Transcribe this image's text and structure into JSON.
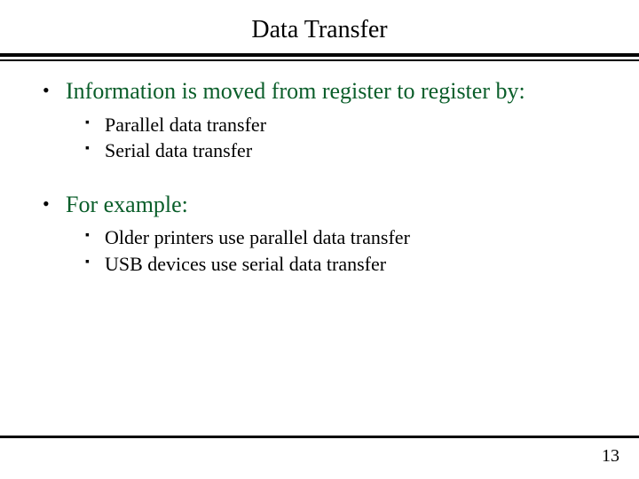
{
  "title": "Data Transfer",
  "bullets": [
    {
      "text": "Information is moved from register to register by:",
      "subs": [
        "Parallel data transfer",
        "Serial data transfer"
      ]
    },
    {
      "text": "For example:",
      "subs": [
        "Older printers use parallel data transfer",
        "USB devices use serial data transfer"
      ]
    }
  ],
  "pageNumber": "13",
  "markers": {
    "level1": "•",
    "level2": "▪"
  }
}
